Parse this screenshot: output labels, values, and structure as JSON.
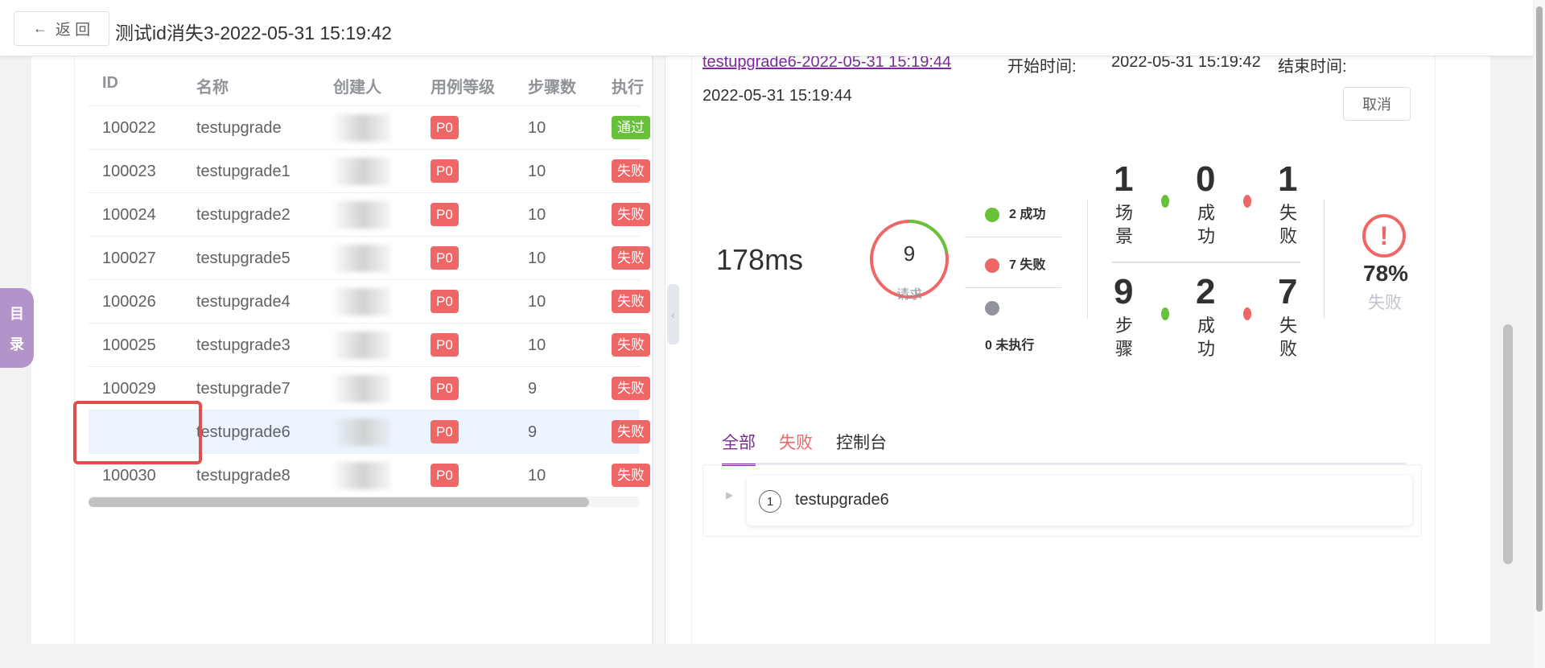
{
  "header": {
    "back_label": "返 回",
    "page_title": "测试id消失3-2022-05-31 15:19:42"
  },
  "side_tab": {
    "chars": [
      "目",
      "录"
    ]
  },
  "table": {
    "columns": [
      "ID",
      "名称",
      "创建人",
      "用例等级",
      "步骤数",
      "执行"
    ],
    "rows": [
      {
        "id": "100022",
        "name": "testupgrade",
        "level": "P0",
        "steps": "10",
        "status": "通过",
        "status_type": "pass",
        "selected": false
      },
      {
        "id": "100023",
        "name": "testupgrade1",
        "level": "P0",
        "steps": "10",
        "status": "失败",
        "status_type": "fail",
        "selected": false
      },
      {
        "id": "100024",
        "name": "testupgrade2",
        "level": "P0",
        "steps": "10",
        "status": "失败",
        "status_type": "fail",
        "selected": false
      },
      {
        "id": "100027",
        "name": "testupgrade5",
        "level": "P0",
        "steps": "10",
        "status": "失败",
        "status_type": "fail",
        "selected": false
      },
      {
        "id": "100026",
        "name": "testupgrade4",
        "level": "P0",
        "steps": "10",
        "status": "失败",
        "status_type": "fail",
        "selected": false
      },
      {
        "id": "100025",
        "name": "testupgrade3",
        "level": "P0",
        "steps": "10",
        "status": "失败",
        "status_type": "fail",
        "selected": false
      },
      {
        "id": "100029",
        "name": "testupgrade7",
        "level": "P0",
        "steps": "9",
        "status": "失败",
        "status_type": "fail",
        "selected": false
      },
      {
        "id": "",
        "name": "testupgrade6",
        "level": "P0",
        "steps": "9",
        "status": "失败",
        "status_type": "fail",
        "selected": true
      },
      {
        "id": "100030",
        "name": "testupgrade8",
        "level": "P0",
        "steps": "10",
        "status": "失败",
        "status_type": "fail",
        "selected": false
      }
    ]
  },
  "report": {
    "link_text": "testupgrade6-2022-05-31 15:19:44",
    "start_label": "开始时间:",
    "start_time": "2022-05-31 15:19:42",
    "end_label": "结束时间:",
    "end_time": "2022-05-31 15:19:44",
    "cancel_label": "取消",
    "duration": "178ms",
    "requests": {
      "total": "9",
      "label": "请求",
      "success": 2,
      "fail": 7
    },
    "legend": {
      "success": "2 成功",
      "fail": "7 失败",
      "not_run": "0 未执行"
    },
    "scenario": {
      "total": "1",
      "label": "场景",
      "success": "0",
      "success_label": "成功",
      "fail": "1",
      "fail_label": "失败"
    },
    "steps": {
      "total": "9",
      "label": "步骤",
      "success": "2",
      "success_label": "成功",
      "fail": "7",
      "fail_label": "失败"
    },
    "fail_rate": "78%",
    "fail_rate_label": "失败",
    "tabs": [
      "全部",
      "失败",
      "控制台"
    ],
    "scenario_item": {
      "index": "1",
      "name": "testupgrade6"
    }
  },
  "colors": {
    "accent": "#7b2b99",
    "success": "#67c23a",
    "fail": "#ee6666",
    "not_run": "#909399"
  }
}
